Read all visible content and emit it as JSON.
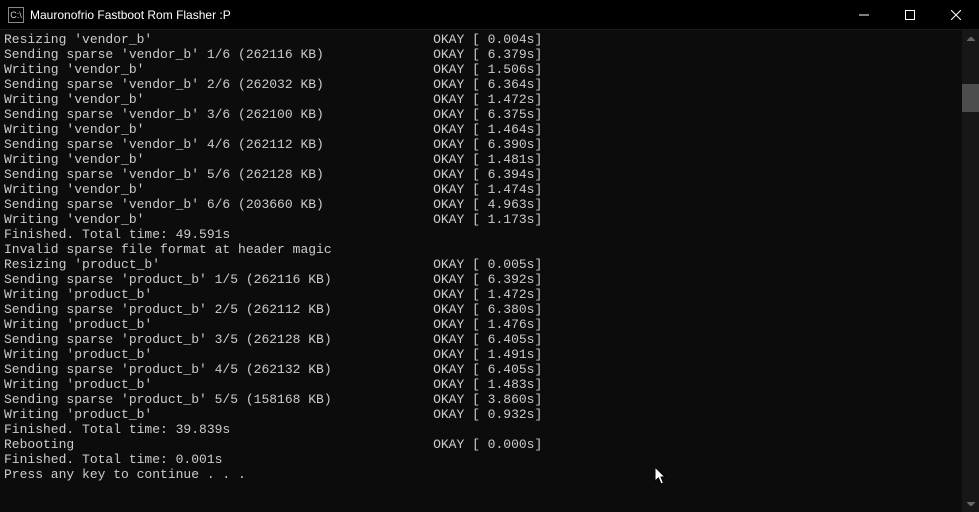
{
  "window": {
    "title": "Mauronofrio Fastboot Rom Flasher :P",
    "icon_label": "C:\\"
  },
  "lines": [
    {
      "left": "Resizing 'vendor_b'",
      "status": "OKAY",
      "time": "0.004s"
    },
    {
      "left": "Sending sparse 'vendor_b' 1/6 (262116 KB)",
      "status": "OKAY",
      "time": "6.379s"
    },
    {
      "left": "Writing 'vendor_b'",
      "status": "OKAY",
      "time": "1.506s"
    },
    {
      "left": "Sending sparse 'vendor_b' 2/6 (262032 KB)",
      "status": "OKAY",
      "time": "6.364s"
    },
    {
      "left": "Writing 'vendor_b'",
      "status": "OKAY",
      "time": "1.472s"
    },
    {
      "left": "Sending sparse 'vendor_b' 3/6 (262100 KB)",
      "status": "OKAY",
      "time": "6.375s"
    },
    {
      "left": "Writing 'vendor_b'",
      "status": "OKAY",
      "time": "1.464s"
    },
    {
      "left": "Sending sparse 'vendor_b' 4/6 (262112 KB)",
      "status": "OKAY",
      "time": "6.390s"
    },
    {
      "left": "Writing 'vendor_b'",
      "status": "OKAY",
      "time": "1.481s"
    },
    {
      "left": "Sending sparse 'vendor_b' 5/6 (262128 KB)",
      "status": "OKAY",
      "time": "6.394s"
    },
    {
      "left": "Writing 'vendor_b'",
      "status": "OKAY",
      "time": "1.474s"
    },
    {
      "left": "Sending sparse 'vendor_b' 6/6 (203660 KB)",
      "status": "OKAY",
      "time": "4.963s"
    },
    {
      "left": "Writing 'vendor_b'",
      "status": "OKAY",
      "time": "1.173s"
    },
    {
      "plain": "Finished. Total time: 49.591s"
    },
    {
      "plain": "Invalid sparse file format at header magic"
    },
    {
      "left": "Resizing 'product_b'",
      "status": "OKAY",
      "time": "0.005s"
    },
    {
      "left": "Sending sparse 'product_b' 1/5 (262116 KB)",
      "status": "OKAY",
      "time": "6.392s"
    },
    {
      "left": "Writing 'product_b'",
      "status": "OKAY",
      "time": "1.472s"
    },
    {
      "left": "Sending sparse 'product_b' 2/5 (262112 KB)",
      "status": "OKAY",
      "time": "6.380s"
    },
    {
      "left": "Writing 'product_b'",
      "status": "OKAY",
      "time": "1.476s"
    },
    {
      "left": "Sending sparse 'product_b' 3/5 (262128 KB)",
      "status": "OKAY",
      "time": "6.405s"
    },
    {
      "left": "Writing 'product_b'",
      "status": "OKAY",
      "time": "1.491s"
    },
    {
      "left": "Sending sparse 'product_b' 4/5 (262132 KB)",
      "status": "OKAY",
      "time": "6.405s"
    },
    {
      "left": "Writing 'product_b'",
      "status": "OKAY",
      "time": "1.483s"
    },
    {
      "left": "Sending sparse 'product_b' 5/5 (158168 KB)",
      "status": "OKAY",
      "time": "3.860s"
    },
    {
      "left": "Writing 'product_b'",
      "status": "OKAY",
      "time": "0.932s"
    },
    {
      "plain": "Finished. Total time: 39.839s"
    },
    {
      "left": "Rebooting",
      "status": "OKAY",
      "time": "0.000s"
    },
    {
      "plain": "Finished. Total time: 0.001s"
    },
    {
      "plain": "Press any key to continue . . ."
    }
  ],
  "layout": {
    "left_col_width": 55,
    "time_width": 7
  }
}
